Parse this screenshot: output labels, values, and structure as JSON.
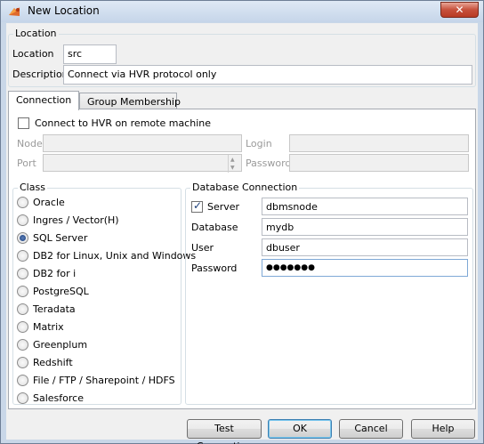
{
  "window": {
    "title": "New Location",
    "close": "✕"
  },
  "location_group": {
    "title": "Location",
    "location_label": "Location",
    "location_value": "src",
    "description_label": "Description",
    "description_value": "Connect via HVR protocol only"
  },
  "tabs": [
    {
      "label": "Connection",
      "active": true
    },
    {
      "label": "Group Membership",
      "active": false
    }
  ],
  "remote": {
    "checkbox_label": "Connect to HVR on remote machine",
    "checked": false,
    "node_label": "Node",
    "port_label": "Port",
    "login_label": "Login",
    "password_label": "Password"
  },
  "class_group": {
    "title": "Class",
    "options": [
      {
        "label": "Oracle",
        "selected": false
      },
      {
        "label": "Ingres / Vector(H)",
        "selected": false
      },
      {
        "label": "SQL Server",
        "selected": true
      },
      {
        "label": "DB2 for Linux, Unix and Windows",
        "selected": false
      },
      {
        "label": "DB2 for i",
        "selected": false
      },
      {
        "label": "PostgreSQL",
        "selected": false
      },
      {
        "label": "Teradata",
        "selected": false
      },
      {
        "label": "Matrix",
        "selected": false
      },
      {
        "label": "Greenplum",
        "selected": false
      },
      {
        "label": "Redshift",
        "selected": false
      },
      {
        "label": "File / FTP / Sharepoint / HDFS",
        "selected": false
      },
      {
        "label": "Salesforce",
        "selected": false
      }
    ]
  },
  "db_group": {
    "title": "Database Connection",
    "server_label": "Server",
    "server_checked": true,
    "server_value": "dbmsnode",
    "database_label": "Database",
    "database_value": "mydb",
    "user_label": "User",
    "user_value": "dbuser",
    "password_label": "Password",
    "password_value": "●●●●●●●"
  },
  "buttons": {
    "test": "Test Connection",
    "ok": "OK",
    "cancel": "Cancel",
    "help": "Help"
  },
  "colors": {
    "accent": "#3c7fb1",
    "title_bg": "#c9d7e8"
  }
}
